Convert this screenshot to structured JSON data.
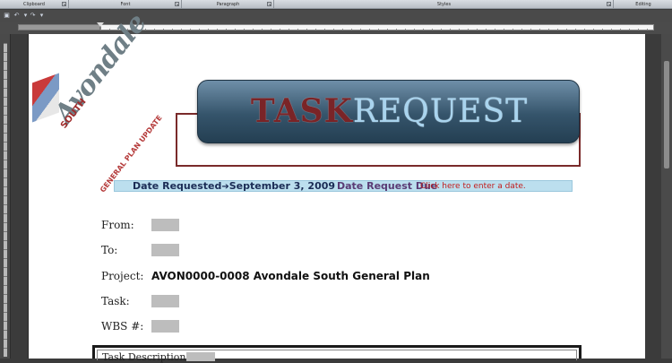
{
  "ribbon": {
    "groups": [
      "Clipboard",
      "Font",
      "Paragraph",
      "Styles",
      "Editing"
    ]
  },
  "banner": {
    "task": "TASK",
    "request": "REQUEST"
  },
  "logo": {
    "name": "Avondale",
    "south": "SOUTH",
    "subtitle": "GENERAL PLAN UPDATE"
  },
  "dates": {
    "requested_label": "Date Requested",
    "requested_value": "September 3, 2009",
    "due_label": "Date Request Due",
    "due_placeholder": "Click here to enter a date."
  },
  "fields": {
    "from_label": "From:",
    "to_label": "To:",
    "project_label": "Project:",
    "project_value": "AVON0000-0008 Avondale South General Plan",
    "task_label": "Task:",
    "wbs_label": "WBS #:"
  },
  "task_description": {
    "label": "Task Description:"
  },
  "icons": {
    "save": "save-icon",
    "undo": "undo-icon",
    "redo": "redo-icon",
    "arrow": "right-arrow-icon"
  },
  "colors": {
    "banner": "#35546b",
    "task_text": "#7a2427",
    "request_text": "#a9d4ee",
    "datebar_bg": "#bcdfee",
    "due_placeholder": "#c21d1d",
    "field_box": "#bdbdbd"
  }
}
